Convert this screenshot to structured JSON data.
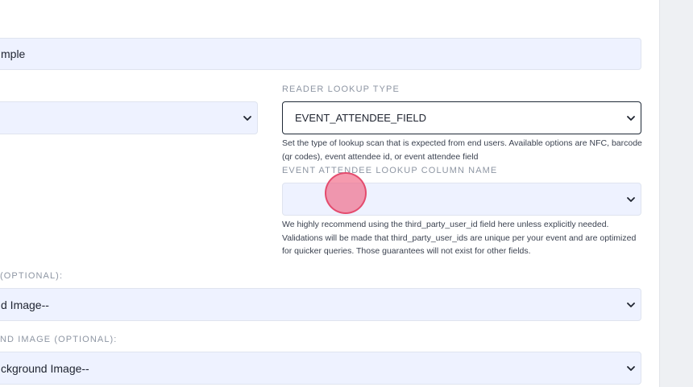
{
  "name_input": {
    "value": "mple"
  },
  "left_select": {
    "value": ""
  },
  "reader_lookup": {
    "label": "READER LOOKUP TYPE",
    "value": "EVENT_ATTENDEE_FIELD",
    "help": "Set the type of lookup scan that is expected from end users. Available options are NFC, barcode (qr codes), event attendee id, or event attendee field"
  },
  "attendee_column": {
    "label": "EVENT ATTENDEE LOOKUP COLUMN NAME",
    "value": "",
    "help": "We highly recommend using the third_party_user_id field here unless explicitly needed. Validations will be made that third_party_user_ids are unique per your event and are optimized for quicker queries. Those guarantees will not exist for other fields."
  },
  "image_optional": {
    "label": "(OPTIONAL):",
    "value": "d Image--"
  },
  "background_image_optional": {
    "label": "ND IMAGE (OPTIONAL):",
    "value": "ckground Image--"
  },
  "icons": {
    "dropdown": "chevron-down-icon"
  },
  "colors": {
    "field_bg": "#eef2ff",
    "active_border": "#1f2937",
    "cursor_highlight": "#ef6482"
  }
}
